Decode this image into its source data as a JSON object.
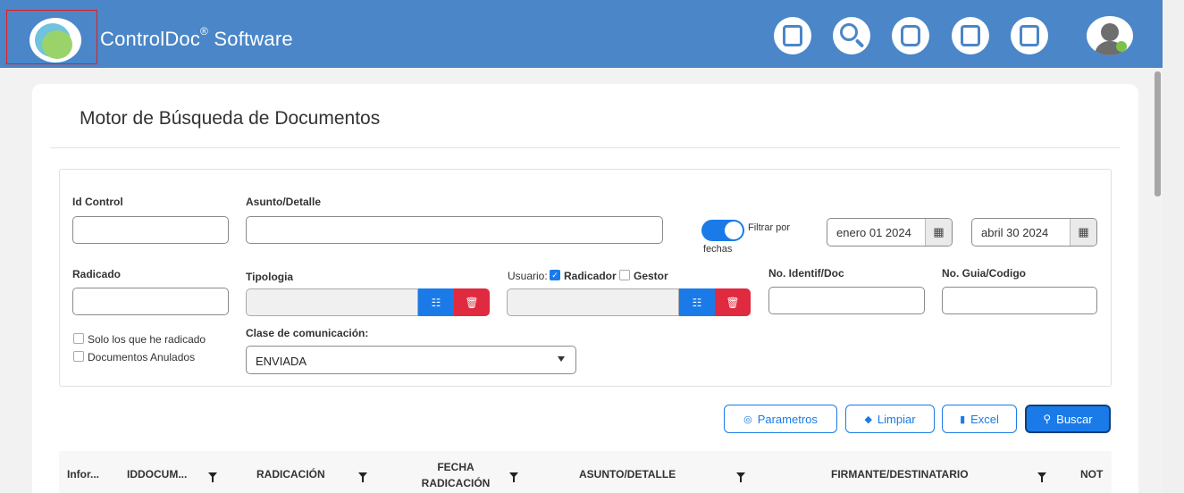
{
  "header": {
    "brand": "ControlDoc",
    "brand_mark": "®",
    "brand_suffix": " Software",
    "icons": [
      "document-icon",
      "search-icon",
      "inbox-tray-icon",
      "archive-icon",
      "report-icon",
      "user-avatar-icon"
    ],
    "color": "#4a86c8"
  },
  "page": {
    "title": "Motor de Búsqueda de Documentos"
  },
  "filters": {
    "id_control": {
      "label": "Id Control",
      "value": ""
    },
    "asunto": {
      "label": "Asunto/Detalle",
      "value": ""
    },
    "filtrar_fechas": {
      "label_a": "Filtrar por",
      "label_b": "fechas",
      "on": true
    },
    "fecha_desde": "enero 01 2024",
    "fecha_hasta": "abril 30 2024",
    "radicado": {
      "label": "Radicado",
      "value": ""
    },
    "tipologia": {
      "label": "Tipologia",
      "value": ""
    },
    "usuario": {
      "label": "Usuario:",
      "radicador": "Radicador",
      "gestor": "Gestor",
      "radicador_checked": true,
      "gestor_checked": false
    },
    "no_identif": {
      "label": "No. Identif/Doc",
      "value": ""
    },
    "no_guia": {
      "label": "No. Guia/Codigo",
      "value": ""
    },
    "solo_radicado": "Solo los que he radicado",
    "anulados": "Documentos Anulados",
    "clase": {
      "label": "Clase de comunicación:",
      "value": "ENVIADA"
    }
  },
  "actions": {
    "parametros": "Parametros",
    "limpiar": "Limpiar",
    "excel": "Excel",
    "buscar": "Buscar"
  },
  "table": {
    "columns": [
      {
        "label": "Infor...",
        "filter": false
      },
      {
        "label": "IDDOCUM...",
        "filter": true
      },
      {
        "label": "RADICACIÓN",
        "filter": true
      },
      {
        "label": "FECHA RADICACIÓN",
        "filter": true
      },
      {
        "label": "ASUNTO/DETALLE",
        "filter": true
      },
      {
        "label": "FIRMANTE/DESTINATARIO",
        "filter": true
      },
      {
        "label": "NOT",
        "filter": false
      }
    ]
  }
}
